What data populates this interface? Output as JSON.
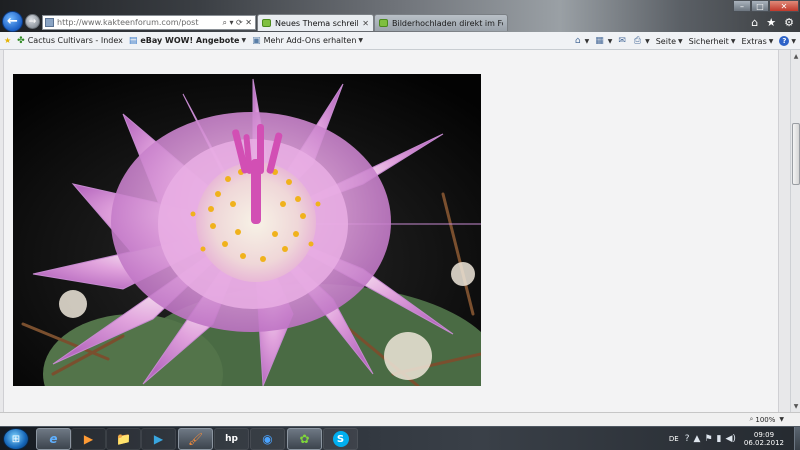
{
  "browser": {
    "address_url": "http://www.kakteenforum.com/post",
    "address_controls": "⌕ ▾ ⟳ ✕",
    "tabs": [
      {
        "label": "Neues Thema schreiben",
        "active": true
      },
      {
        "label": "Bilderhochladen direkt im Foru...",
        "active": false
      }
    ],
    "window_buttons": {
      "minimize": "–",
      "maximize": "□",
      "close": "✕"
    },
    "right_icons": {
      "home": "⌂",
      "favorites": "★",
      "tools": "⚙"
    }
  },
  "favorites_bar": {
    "items": [
      {
        "label": "Cactus Cultivars - Index",
        "icon": "cactus-icon"
      },
      {
        "label": "eBay WOW! Angebote",
        "icon": "ebay-icon",
        "bold": true,
        "dropdown": true
      },
      {
        "label": "Mehr Add-Ons erhalten",
        "icon": "addon-icon",
        "dropdown": true
      }
    ]
  },
  "command_bar": {
    "seite": "Seite",
    "sicherheit": "Sicherheit",
    "extras": "Extras",
    "help": "?"
  },
  "status_bar": {
    "zoom": "100%"
  },
  "taskbar": {
    "language": "DE",
    "time": "09:09",
    "date": "06.02.2012",
    "apps": [
      {
        "name": "internet-explorer",
        "glyph": "e",
        "active": true
      },
      {
        "name": "media-player",
        "glyph": "▶",
        "active": false
      },
      {
        "name": "file-explorer",
        "glyph": "📁",
        "active": false
      },
      {
        "name": "windows-media-center",
        "glyph": "▶",
        "active": false
      },
      {
        "name": "paint",
        "glyph": "🖌",
        "active": false
      },
      {
        "name": "hp-printer",
        "glyph": "hp",
        "active": false
      },
      {
        "name": "google-earth",
        "glyph": "◉",
        "active": false
      },
      {
        "name": "icq",
        "glyph": "✿",
        "active": true
      },
      {
        "name": "skype",
        "glyph": "S",
        "active": false
      }
    ]
  },
  "colors": {
    "ie_blue": "#1b5fc4",
    "flower_pink": "#d98ad8",
    "stamen_yellow": "#f0b21c"
  }
}
